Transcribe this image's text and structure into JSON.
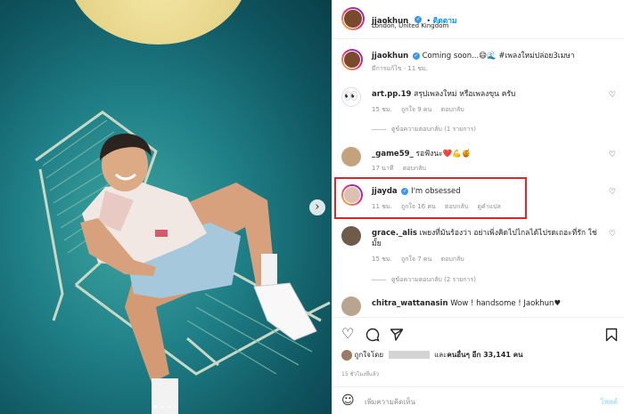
{
  "header": {
    "username": "jjaokhun",
    "follow_label": "ติดตาม",
    "location": "London, United Kingdom"
  },
  "caption": {
    "username": "jjaokhun",
    "text": "Coming soon...😄🌊 #เพลงใหม่ปล่อย3เมษา",
    "meta": "มีการแก้ไข · 11 ชม."
  },
  "comments": [
    {
      "username": "art.pp.19",
      "text": "สรุปเพลงใหม่ หรือเพลงขุน ครับ",
      "time": "15 ชม.",
      "likes": "ถูกใจ 9 คน",
      "reply": "ตอบกลับ",
      "view_replies": "ดูข้อความตอบกลับ (1 รายการ)"
    },
    {
      "username": "_game59_",
      "text": "รอฟังนะ❤️💪🍯",
      "time": "17 นาที",
      "reply": "ตอบกลับ"
    },
    {
      "username": "jjayda",
      "text": "I'm obsessed",
      "time": "11 ชม.",
      "likes": "ถูกใจ 16 คน",
      "reply": "ตอบกลับ",
      "translate": "ดูคำแปล"
    },
    {
      "username": "grace._alis",
      "text": "เพยงที่มันร้องว่า อย่าเพิ่งคิดไปไกลได้ไปรดเถอะที่รัก ใช่มั้ย",
      "time": "15 ชม.",
      "likes": "ถูกใจ 7 คน",
      "reply": "ตอบกลับ",
      "view_replies": "ดูข้อความตอบกลับ (2 รายการ)"
    },
    {
      "username": "chitra_wattanasin",
      "text": "Wow ! handsome ! Jaokhun♥"
    }
  ],
  "likes": {
    "prefix": "ถูกใจโดย",
    "middle": "และ",
    "others": "คนอื่นๆ อีก 33,141 คน"
  },
  "posted_time": "15 ชั่วโมงที่แล้ว",
  "add_comment": {
    "placeholder": "เพิ่มความคิดเห็น",
    "post_label": "โพสต์"
  },
  "icons": {
    "next": "›",
    "heart": "♡",
    "emoji": "☺"
  },
  "colors": {
    "highlight": "#e3242b",
    "link": "#0095f6",
    "verified": "#3897f0"
  }
}
